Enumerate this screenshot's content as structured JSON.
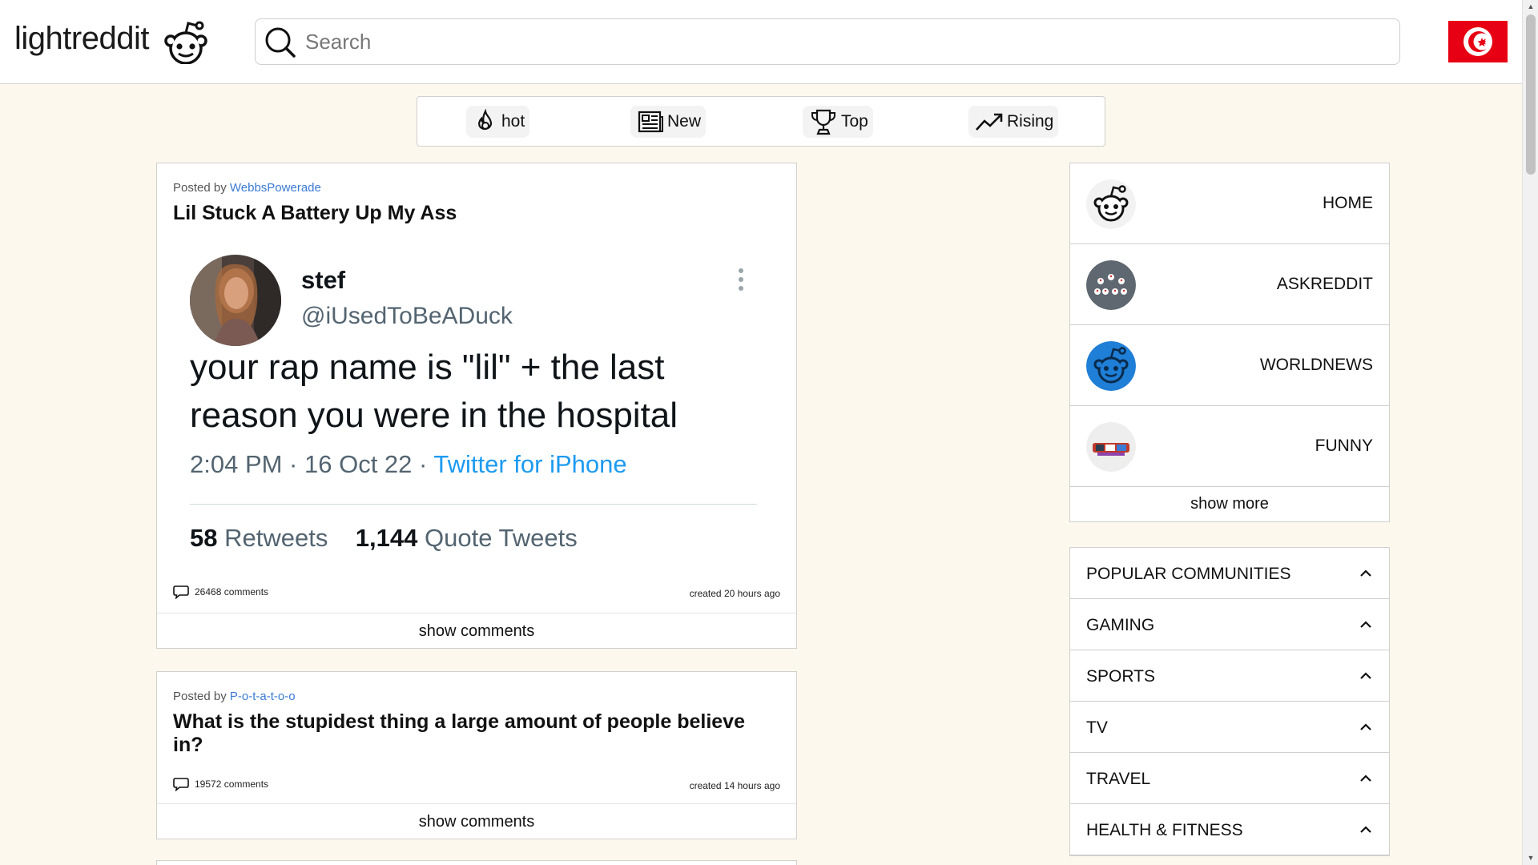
{
  "header": {
    "logo_text": "lightreddit",
    "search_placeholder": "Search"
  },
  "sort": [
    {
      "label": "hot",
      "icon": "flame-icon"
    },
    {
      "label": "New",
      "icon": "newspaper-icon"
    },
    {
      "label": "Top",
      "icon": "trophy-icon"
    },
    {
      "label": "Rising",
      "icon": "trending-up-icon"
    }
  ],
  "posts": [
    {
      "posted_by_prefix": "Posted by",
      "author": "WebbsPowerade",
      "title": "Lil Stuck A Battery Up My Ass",
      "tweet": {
        "name": "stef",
        "handle": "@iUsedToBeADuck",
        "text": "your rap name is \"lil\" + the last reason you were in the hospital",
        "time": "2:04 PM · 16 Oct 22 · ",
        "source": "Twitter for iPhone",
        "retweets": "58",
        "retweets_label": "Retweets",
        "quotes": "1,144",
        "quotes_label": "Quote Tweets"
      },
      "comments": "26468 comments",
      "created": "created 20 hours ago",
      "show_comments": "show comments"
    },
    {
      "posted_by_prefix": "Posted by",
      "author": "P-o-t-a-t-o-o",
      "title": "What is the stupidest thing a large amount of people believe in?",
      "comments": "19572 comments",
      "created": "created 14 hours ago",
      "show_comments": "show comments"
    }
  ],
  "nav": {
    "items": [
      {
        "label": "HOME"
      },
      {
        "label": "ASKREDDIT"
      },
      {
        "label": "WORLDNEWS"
      },
      {
        "label": "FUNNY"
      }
    ],
    "show_more": "show more"
  },
  "communities": [
    {
      "label": "POPULAR COMMUNITIES"
    },
    {
      "label": "GAMING"
    },
    {
      "label": "SPORTS"
    },
    {
      "label": "TV"
    },
    {
      "label": "TRAVEL"
    },
    {
      "label": "HEALTH & FITNESS"
    }
  ],
  "colors": {
    "background": "#fdf8ed",
    "link": "#3a7bd5",
    "flag_red": "#e70013",
    "twitter_blue": "#1d9bf0"
  }
}
